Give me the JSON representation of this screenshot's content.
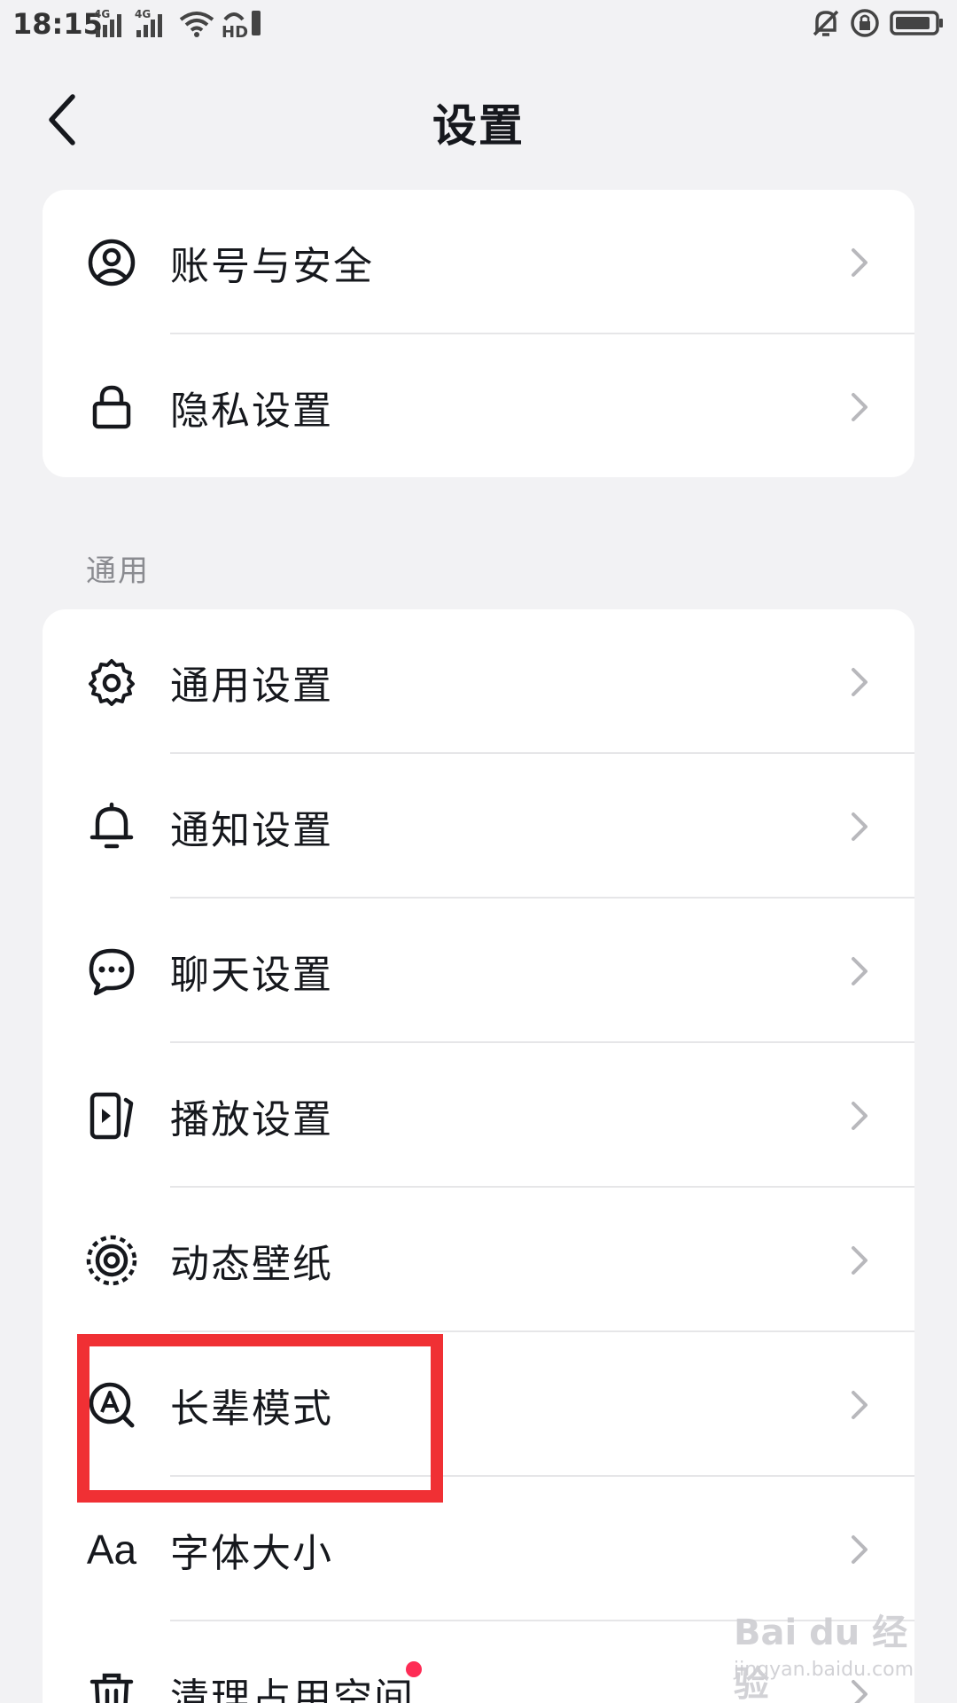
{
  "status_bar": {
    "time": "18:15",
    "network_1": "4G",
    "network_2": "4G",
    "hd_label": "HD"
  },
  "header": {
    "title": "设置",
    "back_icon": "chevron-left-icon"
  },
  "account_card": {
    "items": [
      {
        "label": "账号与安全",
        "icon": "user-circle-icon"
      },
      {
        "label": "隐私设置",
        "icon": "lock-icon"
      }
    ]
  },
  "general_section": {
    "heading": "通用",
    "items": [
      {
        "label": "通用设置",
        "icon": "gear-icon"
      },
      {
        "label": "通知设置",
        "icon": "bell-icon"
      },
      {
        "label": "聊天设置",
        "icon": "chat-bubble-icon"
      },
      {
        "label": "播放设置",
        "icon": "play-screen-icon"
      },
      {
        "label": "动态壁纸",
        "icon": "dynamic-wallpaper-icon"
      },
      {
        "label": "长辈模式",
        "icon": "elder-mode-icon"
      },
      {
        "label": "字体大小",
        "icon": "font-size-icon",
        "glyph": "Aa"
      },
      {
        "label": "清理占用空间",
        "icon": "trash-icon",
        "badge": "red-dot"
      }
    ]
  },
  "colors": {
    "background": "#f2f2f4",
    "card": "#ffffff",
    "text": "#16181d",
    "secondary_text": "#8a8b90",
    "chevron": "#b8b8bc",
    "badge": "#fe2c55",
    "highlight": "#f03034"
  },
  "watermark": {
    "text": "Bai du 经验",
    "url": "jingyan.baidu.com"
  }
}
